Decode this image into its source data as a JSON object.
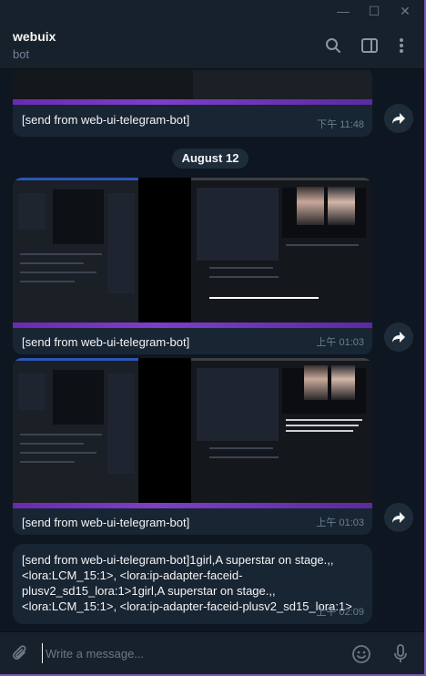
{
  "window": {
    "minimize_glyph": "—",
    "maximize_glyph": "☐",
    "close_glyph": "✕"
  },
  "header": {
    "title": "webuix",
    "subtitle": "bot",
    "icons": [
      "search-icon",
      "sidebar-toggle-icon",
      "more-vertical-icon"
    ]
  },
  "date_separator": "August 12",
  "messages": [
    {
      "caption": "[send from web-ui-telegram-bot]",
      "time": "下午 11:48",
      "has_image": true
    },
    {
      "caption": "[send from web-ui-telegram-bot]",
      "time": "上午 01:03",
      "has_image": true
    },
    {
      "caption": "[send from web-ui-telegram-bot]",
      "time": "上午 01:03",
      "has_image": true
    },
    {
      "caption": "[send from web-ui-telegram-bot]1girl,A superstar on stage.,, <lora:LCM_15:1>, <lora:ip-adapter-faceid-plusv2_sd15_lora:1>1girl,A superstar on stage.,, <lora:LCM_15:1>, <lora:ip-adapter-faceid-plusv2_sd15_lora:1>",
      "time": "上午 02:09",
      "has_image": false
    }
  ],
  "composer": {
    "placeholder": "Write a message...",
    "value": ""
  },
  "colors": {
    "background": "#0e1621",
    "header": "#17212b",
    "bubble": "#182533",
    "frame_accent": "#7b5bb3"
  }
}
